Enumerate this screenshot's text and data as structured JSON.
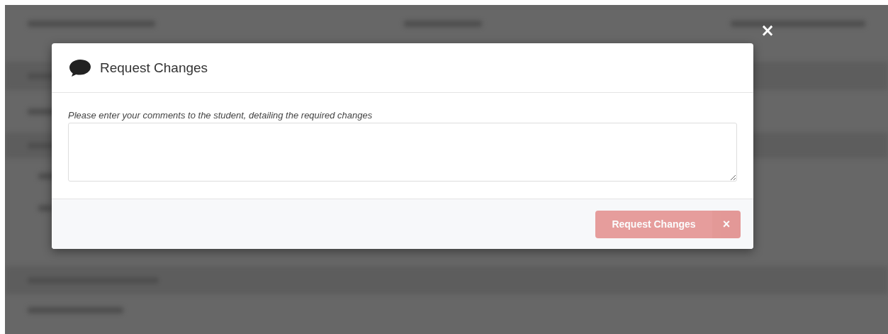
{
  "overlay_close": "×",
  "dialog": {
    "title": "Request Changes",
    "prompt": "Please enter your comments to the student, detailing the required changes",
    "submit": {
      "label": "Request Changes",
      "dismiss": "×",
      "disabled": true
    }
  }
}
